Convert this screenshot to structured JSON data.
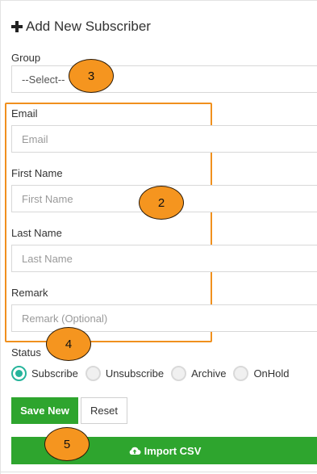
{
  "header": {
    "title": "Add New Subscriber",
    "icon": "plus-icon"
  },
  "group": {
    "label": "Group",
    "selected": "--Select--"
  },
  "email": {
    "label": "Email",
    "placeholder": "Email"
  },
  "first_name": {
    "label": "First Name",
    "placeholder": "First Name"
  },
  "last_name": {
    "label": "Last Name",
    "placeholder": "Last Name"
  },
  "remark": {
    "label": "Remark",
    "placeholder": "Remark (Optional)"
  },
  "status": {
    "label": "Status",
    "options": [
      "Subscribe",
      "Unsubscribe",
      "Archive",
      "OnHold"
    ],
    "selected": "Subscribe"
  },
  "buttons": {
    "save": "Save New",
    "reset": "Reset",
    "import": "Import CSV"
  },
  "markers": [
    "3",
    "2",
    "4",
    "5"
  ],
  "colors": {
    "accent_green": "#2ea52e",
    "radio_teal": "#26b49b",
    "marker_orange": "#f5951f"
  }
}
